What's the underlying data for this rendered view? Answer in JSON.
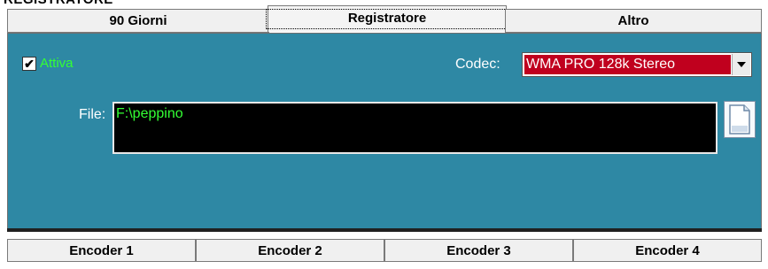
{
  "section": {
    "title": "REGISTRATORE"
  },
  "tabs": [
    {
      "label": "90 Giorni"
    },
    {
      "label": "Registratore"
    },
    {
      "label": "Altro"
    }
  ],
  "recorder": {
    "enabled_label": "Attiva",
    "enabled_checked": true,
    "checkmark": "✔",
    "codec_label": "Codec:",
    "codec_value": "WMA PRO 128k Stereo",
    "file_label": "File:",
    "file_value": "F:\\peppino"
  },
  "encoders": [
    {
      "label": "Encoder 1"
    },
    {
      "label": "Encoder 2"
    },
    {
      "label": "Encoder 3"
    },
    {
      "label": "Encoder 4"
    }
  ],
  "colors": {
    "panel": "#2e88a4",
    "accent_green": "#34ff34",
    "codec_highlight": "#c0001e"
  },
  "icons": {
    "file_browse": "document-icon",
    "dropdown": "chevron-down-icon"
  }
}
